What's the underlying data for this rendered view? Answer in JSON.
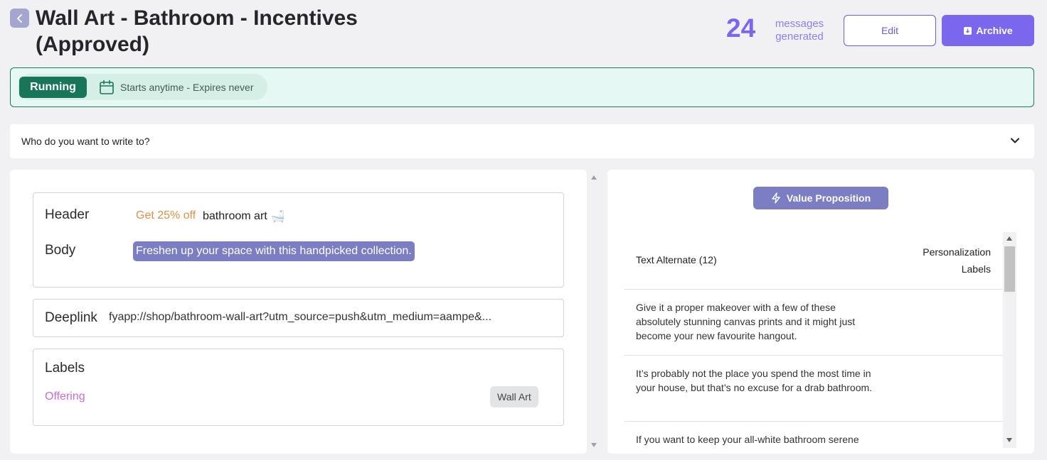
{
  "page": {
    "title": "Wall Art - Bathroom - Incentives (Approved)"
  },
  "stats": {
    "count": "24",
    "count_label": "messages generated"
  },
  "actions": {
    "edit_label": "Edit",
    "archive_label": "Archive"
  },
  "status": {
    "state": "Running",
    "schedule": "Starts anytime - Expires never",
    "accent_color": "#18755a"
  },
  "audience": {
    "question": "Who do you want to write to?"
  },
  "message": {
    "header_label": "Header",
    "header_highlight": "Get 25% off",
    "header_text": "bathroom art",
    "header_emoji": "🛁",
    "body_label": "Body",
    "body_text": "Freshen up your space with this handpicked collection.",
    "deeplink_label": "Deeplink",
    "deeplink_value": "fyapp://shop/bathroom-wall-art?utm_source=push&utm_medium=aampe&...",
    "labels_title": "Labels",
    "label_category": "Offering",
    "label_value": "Wall Art"
  },
  "value_prop": {
    "button_label": "Value Proposition",
    "col_text": "Text Alternate (12)",
    "col_personalization": "Personalization Labels",
    "rows": [
      {
        "text": "Give it a proper makeover with a few of these absolutely stunning canvas prints and it might just become your new favourite hangout."
      },
      {
        "text": "It’s probably not the place you spend the most time in your house, but that’s no excuse for a drab bathroom."
      },
      {
        "text": "If you want to keep your all-white bathroom serene"
      }
    ]
  },
  "colors": {
    "primary": "#7b67ee",
    "chip": "#7b7ec2",
    "orange": "#e0904b",
    "magenta": "#c86fd9"
  }
}
